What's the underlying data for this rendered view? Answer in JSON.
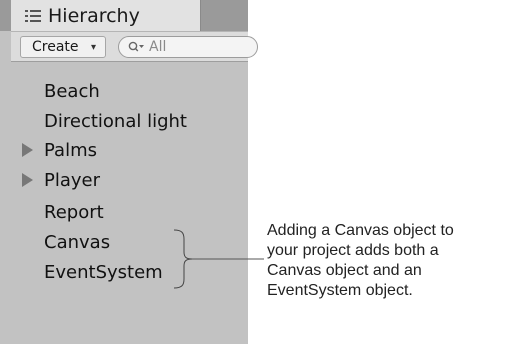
{
  "panel": {
    "tab_title": "Hierarchy",
    "tab_icon": "list-icon",
    "create_label": "Create",
    "create_caret": "▾",
    "search_placeholder": "All",
    "search_icon": "search-icon"
  },
  "hierarchy": {
    "items": [
      {
        "label": "Beach",
        "expandable": false
      },
      {
        "label": "Directional light",
        "expandable": false
      },
      {
        "label": "Palms",
        "expandable": true
      },
      {
        "label": "Player",
        "expandable": true
      },
      {
        "label": "Report",
        "expandable": false
      },
      {
        "label": "Canvas",
        "expandable": false
      },
      {
        "label": "EventSystem",
        "expandable": false
      }
    ]
  },
  "annotation": {
    "lines": [
      "Adding a Canvas object to",
      "your project adds both a",
      "Canvas object and an",
      "EventSystem object."
    ]
  },
  "colors": {
    "panel_bg": "#c2c2c2",
    "tab_bg": "#e2e2e2",
    "toolbar_bg": "#dcdcdc"
  }
}
